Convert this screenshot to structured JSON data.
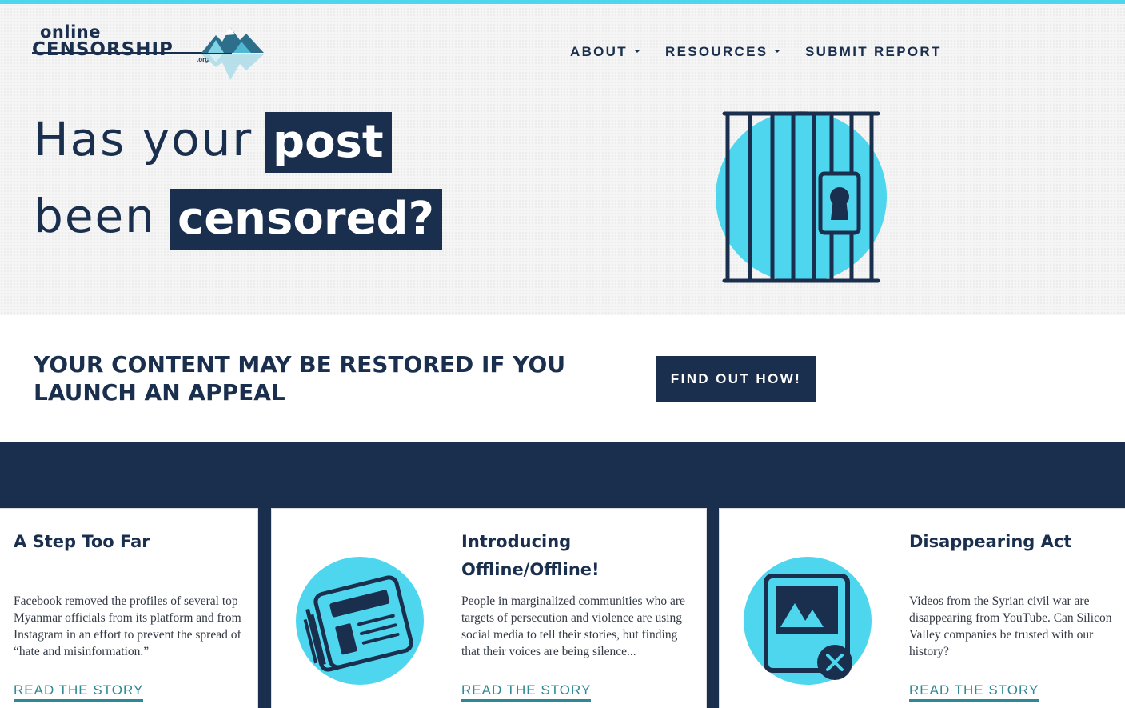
{
  "colors": {
    "navy": "#1a2f4d",
    "cyan": "#4fd6ef",
    "link": "#2d8a94"
  },
  "logo": {
    "line1": "online",
    "line2": "CENSORSHIP",
    "suffix": ".org"
  },
  "nav": {
    "about": "ABOUT",
    "resources": "RESOURCES",
    "submit": "SUBMIT REPORT"
  },
  "hero": {
    "line1_prefix": "Has your",
    "line1_highlight": "post",
    "line2_prefix": "been",
    "line2_highlight": "censored?",
    "icon": "jail-lock-icon"
  },
  "appeal": {
    "title": "YOUR CONTENT MAY BE RESTORED IF YOU LAUNCH AN APPEAL",
    "cta": "FIND OUT HOW!"
  },
  "cards": [
    {
      "title": "A Step Too Far",
      "text": "Facebook removed the profiles of several top Myanmar officials from its platform and from Instagram in an effort to prevent the spread of “hate and misinformation.”",
      "link": "READ THE STORY"
    },
    {
      "title": "Introducing Offline/Offline!",
      "text": "People in marginalized communities who are targets of persecution and violence are using social media to tell their stories, but finding that their voices are being silence...",
      "link": "READ THE STORY",
      "icon": "newspaper-icon"
    },
    {
      "title": "Disappearing Act",
      "text": "Videos from the Syrian civil war are disappearing from YouTube. Can Silicon Valley companies be trusted with our history?",
      "link": "READ THE STORY",
      "icon": "deleted-image-icon"
    }
  ]
}
